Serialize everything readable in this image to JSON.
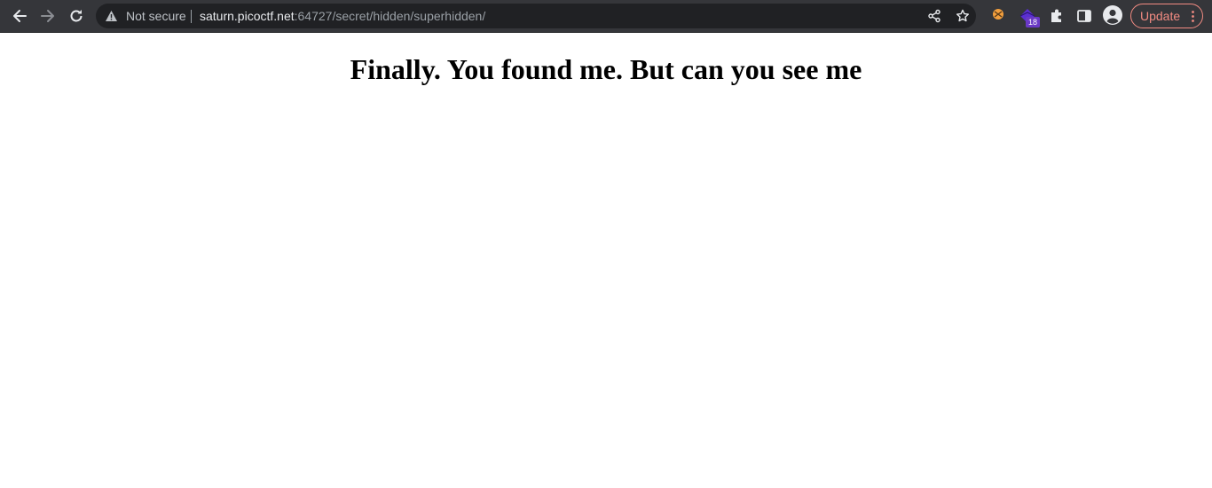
{
  "browser": {
    "security_label": "Not secure",
    "url_host": "saturn.picoctf.net",
    "url_rest": ":64727/secret/hidden/superhidden/",
    "extension_badge": "18",
    "update_label": "Update",
    "icons": {
      "back": "back-arrow-icon",
      "forward": "forward-arrow-icon",
      "reload": "reload-icon",
      "warning": "warning-icon",
      "share": "share-icon",
      "bookmark": "star-icon",
      "extension_1": "extension-icon",
      "extension_2": "extension-icon",
      "extensions": "puzzle-icon",
      "side_panel": "side-panel-icon",
      "profile": "profile-icon",
      "menu": "more-vert-icon"
    },
    "colors": {
      "toolbar": "#35363a",
      "omnibox": "#202124",
      "update_accent": "#f28b82",
      "badge": "#6a39c6"
    }
  },
  "page": {
    "heading": "Finally. You found me. But can you see me"
  }
}
